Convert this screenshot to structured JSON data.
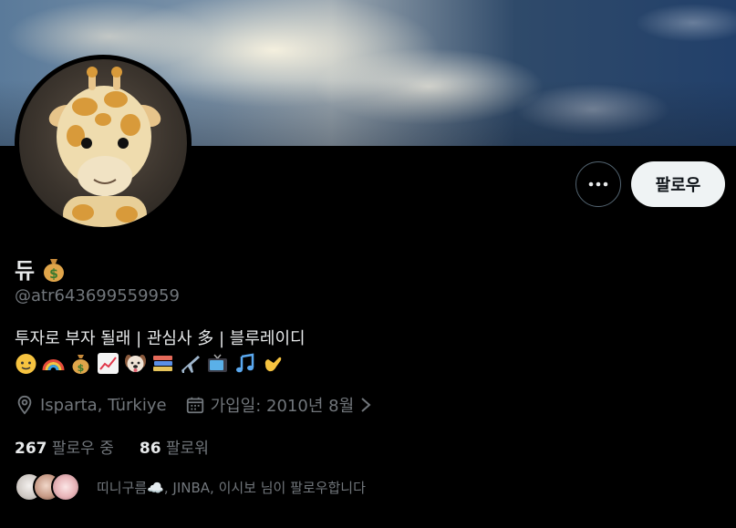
{
  "profile": {
    "name": "듀",
    "name_emoji": "money-bag",
    "handle": "@atr643699559959",
    "bio": "투자로 부자 될래 | 관심사 多 | 블루레이디",
    "bio_emojis": [
      "baby-face",
      "rainbow",
      "money-bag",
      "chart-increasing",
      "dog-face",
      "books",
      "airplane",
      "television",
      "musical-notes",
      "call-me-hand"
    ],
    "location": "Isparta, Türkiye",
    "joined": "가입일: 2010년 8월"
  },
  "actions": {
    "follow_label": "팔로우",
    "more_icon": "more-dots-icon"
  },
  "stats": {
    "following_count": "267",
    "following_label": "팔로우 중",
    "followers_count": "86",
    "followers_label": "팔로워"
  },
  "followed_by": {
    "text": "띠니구름☁️, JINBA, 이시보 님이 팔로우합니다"
  },
  "colors": {
    "background": "#000000",
    "text_primary": "#e7e9ea",
    "text_secondary": "#71767b",
    "follow_bg": "#eff3f4",
    "border": "#536471"
  }
}
